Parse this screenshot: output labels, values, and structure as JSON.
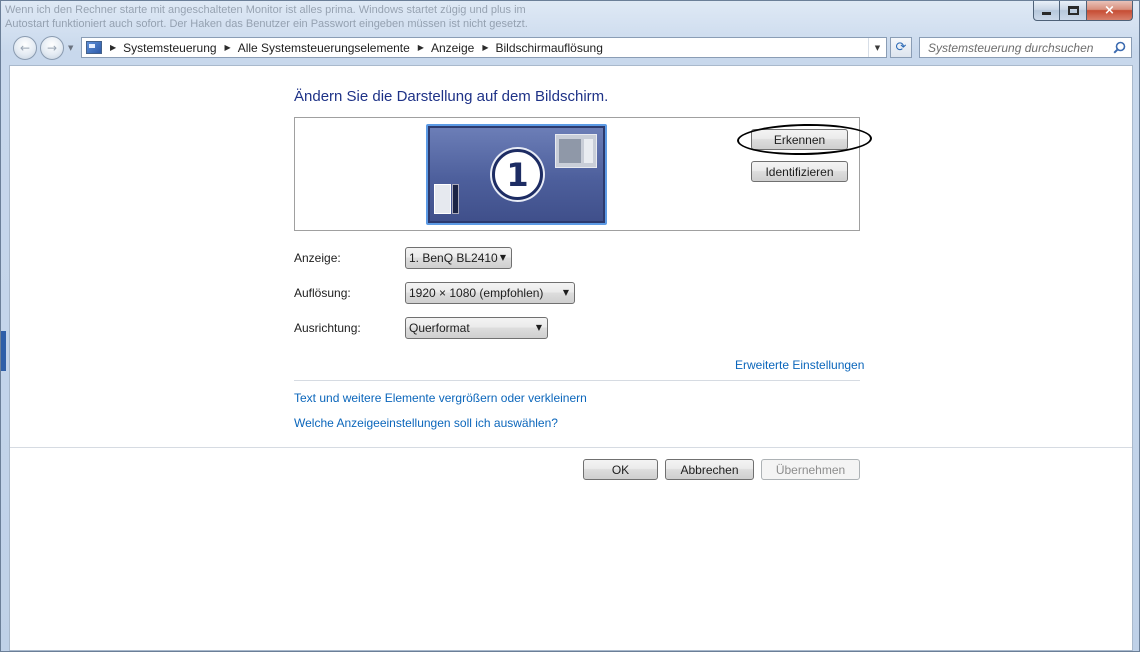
{
  "window": {
    "background_text_lines": [
      "Wenn ich den Rechner starte mit angeschalteten Monitor ist alles prima. Windows startet zügig und plus im",
      "Autostart funktioniert auch sofort. Der Haken das Benutzer ein Passwort eingeben müssen ist nicht gesetzt."
    ],
    "caption": {
      "close_symbol": "×"
    }
  },
  "navigation": {
    "back_symbol": "←",
    "forward_symbol": "→",
    "breadcrumbs": [
      "Systemsteuerung",
      "Alle Systemsteuerungselemente",
      "Anzeige",
      "Bildschirmauflösung"
    ],
    "search_placeholder": "Systemsteuerung durchsuchen"
  },
  "main": {
    "heading": "Ändern Sie die Darstellung auf dem Bildschirm.",
    "monitor_number": "1",
    "detect_button": "Erkennen",
    "identify_button": "Identifizieren",
    "fields": {
      "display_label": "Anzeige:",
      "display_value": "1. BenQ BL2410",
      "resolution_label": "Auflösung:",
      "resolution_value": "1920 × 1080 (empfohlen)",
      "orientation_label": "Ausrichtung:",
      "orientation_value": "Querformat"
    },
    "advanced_link": "Erweiterte Einstellungen",
    "links": [
      "Text und weitere Elemente vergrößern oder verkleinern",
      "Welche Anzeigeeinstellungen soll ich auswählen?"
    ],
    "buttons": {
      "ok": "OK",
      "cancel": "Abbrechen",
      "apply": "Übernehmen"
    }
  },
  "colors": {
    "link": "#0b66bb",
    "heading": "#1e3287",
    "monitor_border": "#5d9be5",
    "annotation": "#000000"
  }
}
